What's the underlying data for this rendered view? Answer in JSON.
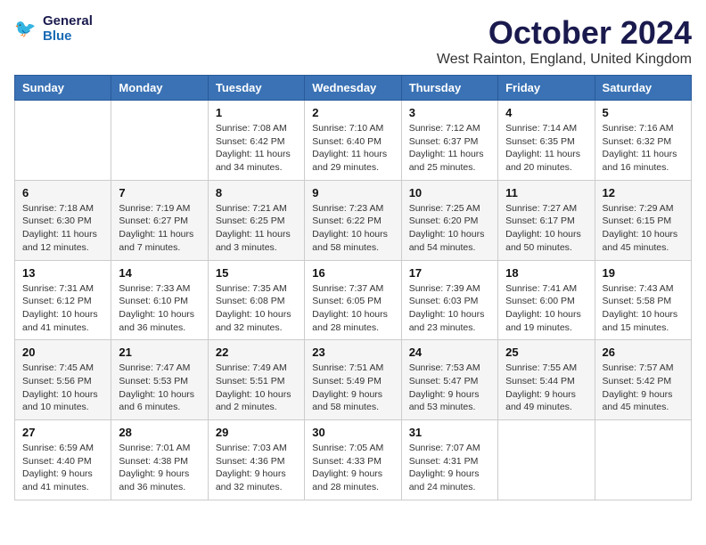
{
  "header": {
    "logo_line1": "General",
    "logo_line2": "Blue",
    "month_title": "October 2024",
    "location": "West Rainton, England, United Kingdom"
  },
  "weekdays": [
    "Sunday",
    "Monday",
    "Tuesday",
    "Wednesday",
    "Thursday",
    "Friday",
    "Saturday"
  ],
  "weeks": [
    [
      {
        "day": "",
        "sunrise": "",
        "sunset": "",
        "daylight": ""
      },
      {
        "day": "",
        "sunrise": "",
        "sunset": "",
        "daylight": ""
      },
      {
        "day": "1",
        "sunrise": "Sunrise: 7:08 AM",
        "sunset": "Sunset: 6:42 PM",
        "daylight": "Daylight: 11 hours and 34 minutes."
      },
      {
        "day": "2",
        "sunrise": "Sunrise: 7:10 AM",
        "sunset": "Sunset: 6:40 PM",
        "daylight": "Daylight: 11 hours and 29 minutes."
      },
      {
        "day": "3",
        "sunrise": "Sunrise: 7:12 AM",
        "sunset": "Sunset: 6:37 PM",
        "daylight": "Daylight: 11 hours and 25 minutes."
      },
      {
        "day": "4",
        "sunrise": "Sunrise: 7:14 AM",
        "sunset": "Sunset: 6:35 PM",
        "daylight": "Daylight: 11 hours and 20 minutes."
      },
      {
        "day": "5",
        "sunrise": "Sunrise: 7:16 AM",
        "sunset": "Sunset: 6:32 PM",
        "daylight": "Daylight: 11 hours and 16 minutes."
      }
    ],
    [
      {
        "day": "6",
        "sunrise": "Sunrise: 7:18 AM",
        "sunset": "Sunset: 6:30 PM",
        "daylight": "Daylight: 11 hours and 12 minutes."
      },
      {
        "day": "7",
        "sunrise": "Sunrise: 7:19 AM",
        "sunset": "Sunset: 6:27 PM",
        "daylight": "Daylight: 11 hours and 7 minutes."
      },
      {
        "day": "8",
        "sunrise": "Sunrise: 7:21 AM",
        "sunset": "Sunset: 6:25 PM",
        "daylight": "Daylight: 11 hours and 3 minutes."
      },
      {
        "day": "9",
        "sunrise": "Sunrise: 7:23 AM",
        "sunset": "Sunset: 6:22 PM",
        "daylight": "Daylight: 10 hours and 58 minutes."
      },
      {
        "day": "10",
        "sunrise": "Sunrise: 7:25 AM",
        "sunset": "Sunset: 6:20 PM",
        "daylight": "Daylight: 10 hours and 54 minutes."
      },
      {
        "day": "11",
        "sunrise": "Sunrise: 7:27 AM",
        "sunset": "Sunset: 6:17 PM",
        "daylight": "Daylight: 10 hours and 50 minutes."
      },
      {
        "day": "12",
        "sunrise": "Sunrise: 7:29 AM",
        "sunset": "Sunset: 6:15 PM",
        "daylight": "Daylight: 10 hours and 45 minutes."
      }
    ],
    [
      {
        "day": "13",
        "sunrise": "Sunrise: 7:31 AM",
        "sunset": "Sunset: 6:12 PM",
        "daylight": "Daylight: 10 hours and 41 minutes."
      },
      {
        "day": "14",
        "sunrise": "Sunrise: 7:33 AM",
        "sunset": "Sunset: 6:10 PM",
        "daylight": "Daylight: 10 hours and 36 minutes."
      },
      {
        "day": "15",
        "sunrise": "Sunrise: 7:35 AM",
        "sunset": "Sunset: 6:08 PM",
        "daylight": "Daylight: 10 hours and 32 minutes."
      },
      {
        "day": "16",
        "sunrise": "Sunrise: 7:37 AM",
        "sunset": "Sunset: 6:05 PM",
        "daylight": "Daylight: 10 hours and 28 minutes."
      },
      {
        "day": "17",
        "sunrise": "Sunrise: 7:39 AM",
        "sunset": "Sunset: 6:03 PM",
        "daylight": "Daylight: 10 hours and 23 minutes."
      },
      {
        "day": "18",
        "sunrise": "Sunrise: 7:41 AM",
        "sunset": "Sunset: 6:00 PM",
        "daylight": "Daylight: 10 hours and 19 minutes."
      },
      {
        "day": "19",
        "sunrise": "Sunrise: 7:43 AM",
        "sunset": "Sunset: 5:58 PM",
        "daylight": "Daylight: 10 hours and 15 minutes."
      }
    ],
    [
      {
        "day": "20",
        "sunrise": "Sunrise: 7:45 AM",
        "sunset": "Sunset: 5:56 PM",
        "daylight": "Daylight: 10 hours and 10 minutes."
      },
      {
        "day": "21",
        "sunrise": "Sunrise: 7:47 AM",
        "sunset": "Sunset: 5:53 PM",
        "daylight": "Daylight: 10 hours and 6 minutes."
      },
      {
        "day": "22",
        "sunrise": "Sunrise: 7:49 AM",
        "sunset": "Sunset: 5:51 PM",
        "daylight": "Daylight: 10 hours and 2 minutes."
      },
      {
        "day": "23",
        "sunrise": "Sunrise: 7:51 AM",
        "sunset": "Sunset: 5:49 PM",
        "daylight": "Daylight: 9 hours and 58 minutes."
      },
      {
        "day": "24",
        "sunrise": "Sunrise: 7:53 AM",
        "sunset": "Sunset: 5:47 PM",
        "daylight": "Daylight: 9 hours and 53 minutes."
      },
      {
        "day": "25",
        "sunrise": "Sunrise: 7:55 AM",
        "sunset": "Sunset: 5:44 PM",
        "daylight": "Daylight: 9 hours and 49 minutes."
      },
      {
        "day": "26",
        "sunrise": "Sunrise: 7:57 AM",
        "sunset": "Sunset: 5:42 PM",
        "daylight": "Daylight: 9 hours and 45 minutes."
      }
    ],
    [
      {
        "day": "27",
        "sunrise": "Sunrise: 6:59 AM",
        "sunset": "Sunset: 4:40 PM",
        "daylight": "Daylight: 9 hours and 41 minutes."
      },
      {
        "day": "28",
        "sunrise": "Sunrise: 7:01 AM",
        "sunset": "Sunset: 4:38 PM",
        "daylight": "Daylight: 9 hours and 36 minutes."
      },
      {
        "day": "29",
        "sunrise": "Sunrise: 7:03 AM",
        "sunset": "Sunset: 4:36 PM",
        "daylight": "Daylight: 9 hours and 32 minutes."
      },
      {
        "day": "30",
        "sunrise": "Sunrise: 7:05 AM",
        "sunset": "Sunset: 4:33 PM",
        "daylight": "Daylight: 9 hours and 28 minutes."
      },
      {
        "day": "31",
        "sunrise": "Sunrise: 7:07 AM",
        "sunset": "Sunset: 4:31 PM",
        "daylight": "Daylight: 9 hours and 24 minutes."
      },
      {
        "day": "",
        "sunrise": "",
        "sunset": "",
        "daylight": ""
      },
      {
        "day": "",
        "sunrise": "",
        "sunset": "",
        "daylight": ""
      }
    ]
  ]
}
